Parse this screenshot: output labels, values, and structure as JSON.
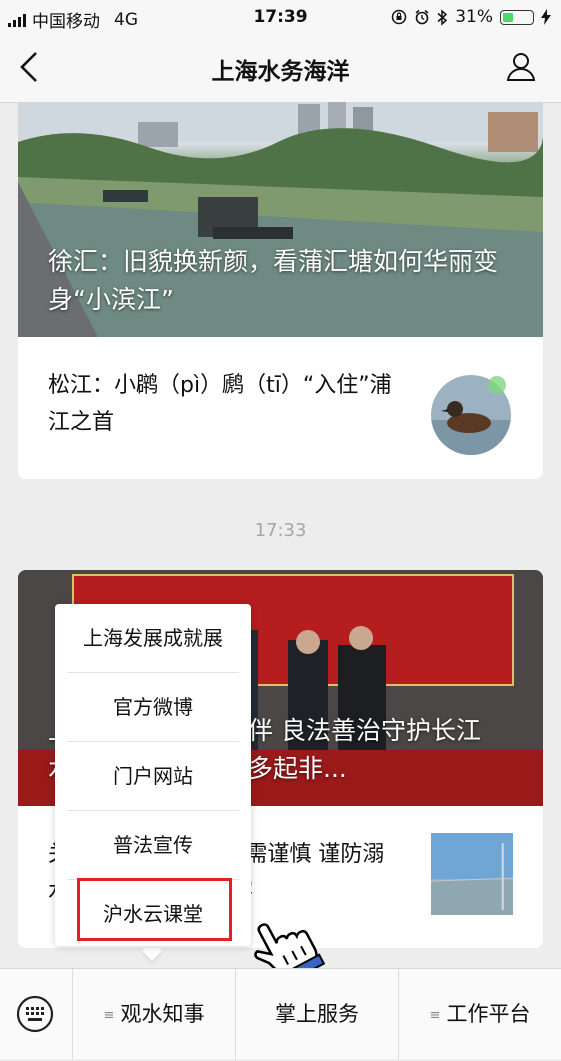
{
  "status": {
    "carrier": "中国移动",
    "network": "4G",
    "time": "17:39",
    "battery": "31%",
    "battery_level": 0.31
  },
  "nav": {
    "title": "上海水务海洋",
    "back_icon": "chevron-left-icon",
    "user_icon": "person-icon"
  },
  "card1": {
    "hero_title": "徐汇：旧貌换新颜，看蒲汇塘如何华丽变身“小滨江”",
    "item_title": "松江：小䴙（pì）䴘（tī）“入住”浦江之首"
  },
  "timestamp": "17:33",
  "card2": {
    "hero_title": "上海携手长三角伙伴 良法善治守护长江 水务部门依法查处多起非...",
    "item_title": "关注 | 江边戏水游泳需谨慎 谨防溺水 远离江边戏水游客"
  },
  "popup": {
    "items": [
      "上海发展成就展",
      "官方微博",
      "门户网站",
      "普法宣传",
      "沪水云课堂"
    ]
  },
  "tabbar": {
    "keyboard_icon": "keyboard-icon",
    "tabs": [
      "观水知事",
      "掌上服务",
      "工作平台"
    ]
  },
  "colors": {
    "highlight": "#e22222",
    "battery_fill": "#4cd964"
  }
}
